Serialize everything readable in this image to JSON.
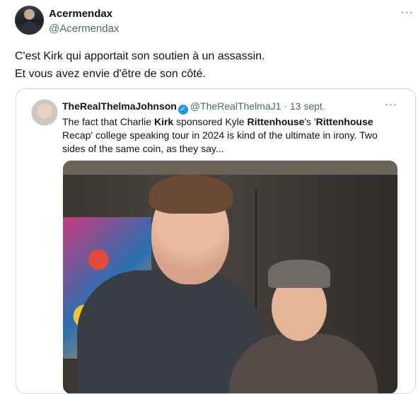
{
  "tweet": {
    "display_name": "Acermendax",
    "handle": "@Acermendax",
    "more_label": "···",
    "text_lines": [
      "C'est Kirk qui apportait son soutien à un assassin.",
      "Et vous avez envie d'être de son côté."
    ]
  },
  "quote": {
    "display_name": "TheRealThelmaJohnson",
    "handle": "@TheRealThelmaJ1",
    "separator": " · ",
    "date": "13 sept.",
    "more_label": "···",
    "verified_icon": "verified-badge-icon",
    "text": {
      "t1": "The fact that Charlie ",
      "b1": "Kirk",
      "t2": " sponsored Kyle ",
      "b2": "Rittenhouse",
      "t3": "'s '",
      "b3": "Rittenhouse",
      "t4": " Recap' college speaking tour in 2024 is kind of the ultimate in irony.  Two sides of the same coin, as they say..."
    }
  },
  "colors": {
    "text": "#0f1419",
    "secondary": "#536471",
    "border": "#cfd9de",
    "verified": "#1d9bf0"
  }
}
